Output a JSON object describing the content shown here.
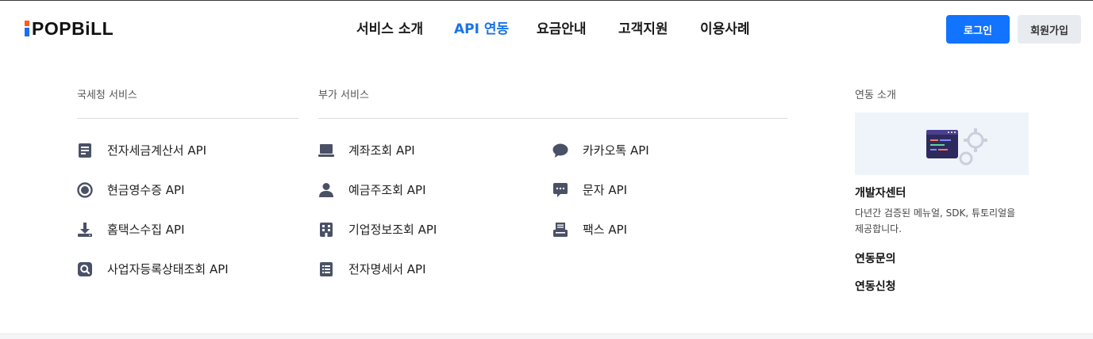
{
  "header": {
    "logo_text": "POPBiLL",
    "nav": [
      {
        "label": "서비스 소개"
      },
      {
        "label": "API 연동"
      },
      {
        "label": "요금안내"
      },
      {
        "label": "고객지원"
      },
      {
        "label": "이용사례"
      }
    ],
    "active_nav": "API 연동",
    "login_label": "로그인",
    "join_label": "회원가입"
  },
  "menu": {
    "nts": {
      "title": "국세청 서비스",
      "items": [
        {
          "label": "전자세금계산서 API",
          "icon": "document-icon"
        },
        {
          "label": "현금영수증 API",
          "icon": "record-circle-icon"
        },
        {
          "label": "홈택스수집 API",
          "icon": "download-icon"
        },
        {
          "label": "사업자등록상태조회 API",
          "icon": "search-icon"
        }
      ]
    },
    "addon": {
      "title": "부가 서비스",
      "items_left": [
        {
          "label": "계좌조회 API",
          "icon": "laptop-icon"
        },
        {
          "label": "예금주조회 API",
          "icon": "user-icon"
        },
        {
          "label": "기업정보조회 API",
          "icon": "building-icon"
        },
        {
          "label": "전자명세서 API",
          "icon": "list-icon"
        }
      ],
      "items_right": [
        {
          "label": "카카오톡 API",
          "icon": "chat-bubble-icon"
        },
        {
          "label": "문자 API",
          "icon": "message-icon"
        },
        {
          "label": "팩스 API",
          "icon": "fax-icon"
        }
      ]
    },
    "intro": {
      "title": "연동 소개",
      "promo_title": "개발자센터",
      "promo_desc_line1": "다년간 검증된 메뉴얼, SDK, 튜토리얼을",
      "promo_desc_line2": "제공합니다.",
      "link_inquiry": "연동문의",
      "link_apply": "연동신청"
    }
  },
  "colors": {
    "accent": "#1173ff",
    "active_nav": "#1a73e8",
    "icon": "#4a5166",
    "logo_orange": "#ff5a1f",
    "logo_blue": "#1a6ff0"
  }
}
